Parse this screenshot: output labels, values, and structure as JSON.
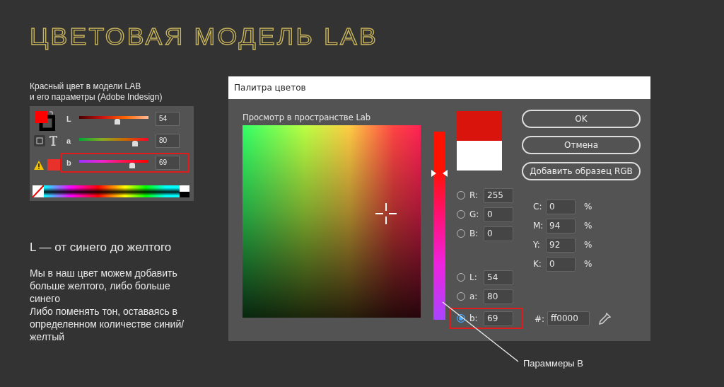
{
  "title": "ЦВЕТОВАЯ МОДЕЛЬ LAB",
  "indesign_panel": {
    "caption": "Красный цвет в модели LAB\nи его параметры (Adobe Indesign)",
    "sliders": [
      {
        "kind": "lightness",
        "label": "L",
        "value": "54",
        "level": 0.55,
        "highlighted": false
      },
      {
        "kind": "green_red",
        "label": "a",
        "value": "80",
        "level": 0.81,
        "highlighted": false
      },
      {
        "kind": "blue_yellow",
        "label": "b",
        "value": "69",
        "level": 0.77,
        "highlighted": true
      }
    ]
  },
  "notes": {
    "heading": "L — от синего до желтого",
    "paragraphs": [
      "Мы в наш цвет можем добавить больше желтого, либо больше синего",
      "Либо поменять тон, оставаясь в определенном количестве синий/желтый"
    ]
  },
  "dialog": {
    "title": "Палитра цветов",
    "preview_label": "Просмотр в пространстве Lab",
    "slider": {
      "level": 0.78
    },
    "buttons": [
      "OK",
      "Отмена",
      "Добавить образец RGB"
    ],
    "rgb_fields": [
      {
        "label": "R:",
        "value": "255",
        "selected": false
      },
      {
        "label": "G:",
        "value": "0",
        "selected": false
      },
      {
        "label": "B:",
        "value": "0",
        "selected": false
      }
    ],
    "lab_fields": [
      {
        "label": "L:",
        "value": "54",
        "selected": false,
        "highlighted": false
      },
      {
        "label": "a:",
        "value": "80",
        "selected": false,
        "highlighted": false
      },
      {
        "label": "b:",
        "value": "69",
        "selected": true,
        "highlighted": true
      }
    ],
    "cmyk_fields": [
      {
        "label": "C:",
        "value": "0",
        "unit": "%"
      },
      {
        "label": "M:",
        "value": "94",
        "unit": "%"
      },
      {
        "label": "Y:",
        "value": "92",
        "unit": "%"
      },
      {
        "label": "K:",
        "value": "0",
        "unit": "%"
      }
    ],
    "hex": {
      "label": "#:",
      "value": "ff0000"
    }
  },
  "callout": {
    "text": "Параммеры В"
  }
}
